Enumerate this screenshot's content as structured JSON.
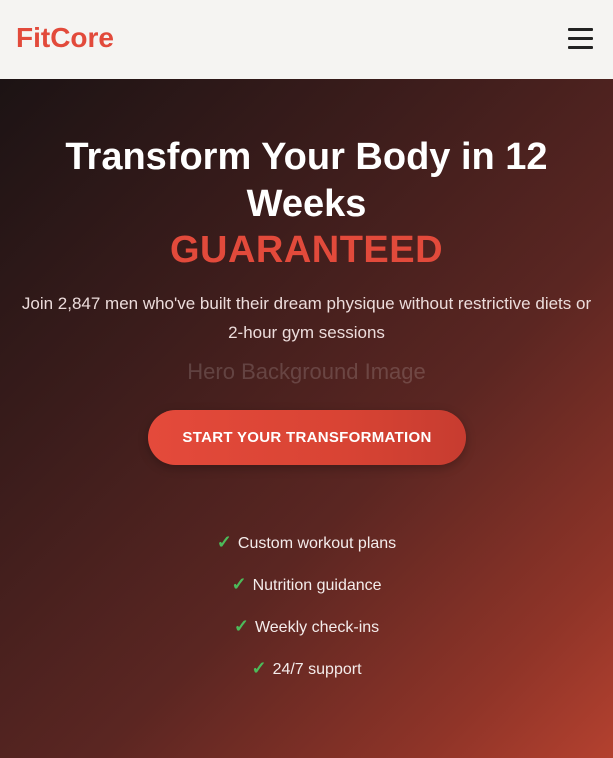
{
  "header": {
    "logo": "FitCore",
    "menu_icon": "hamburger-menu-icon"
  },
  "hero": {
    "headline": "Transform Your Body in 12 Weeks",
    "guarantee": "GUARANTEED",
    "subtext": "Join 2,847 men who've built their dream physique without restrictive diets or 2-hour gym sessions",
    "background_placeholder": "Hero Background Image",
    "cta_label": "START YOUR TRANSFORMATION",
    "features": [
      {
        "icon": "checkmark-icon",
        "glyph": "✓",
        "label": "Custom workout plans"
      },
      {
        "icon": "checkmark-icon",
        "glyph": "✓",
        "label": "Nutrition guidance"
      },
      {
        "icon": "checkmark-icon",
        "glyph": "✓",
        "label": "Weekly check-ins"
      },
      {
        "icon": "checkmark-icon",
        "glyph": "✓",
        "label": "24/7 support"
      }
    ]
  },
  "colors": {
    "brand_red": "#e24a3b",
    "header_bg": "#f5f4f2",
    "check_green": "#4cbb5a"
  }
}
